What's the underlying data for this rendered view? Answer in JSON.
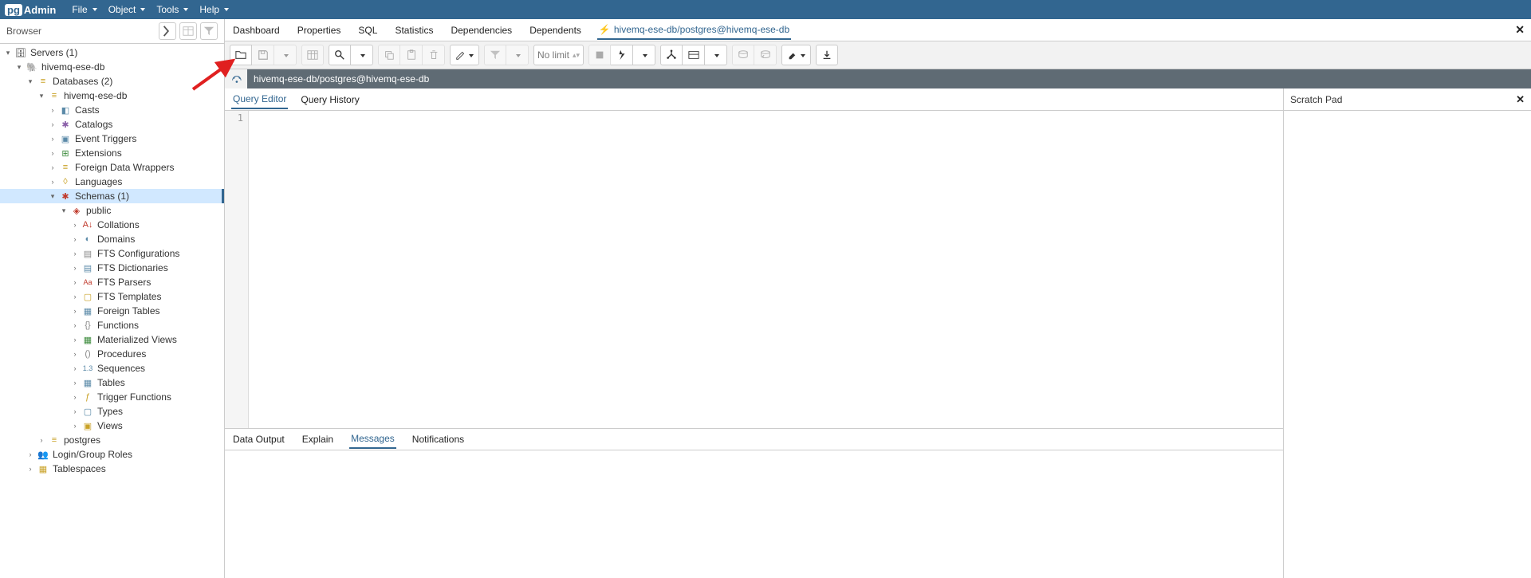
{
  "app": {
    "logo_pg": "pg",
    "logo_admin": "Admin"
  },
  "menu": {
    "file": "File",
    "object": "Object",
    "tools": "Tools",
    "help": "Help"
  },
  "browser": {
    "title": "Browser"
  },
  "tree": {
    "servers": "Servers (1)",
    "server": "hivemq-ese-db",
    "databases": "Databases (2)",
    "db": "hivemq-ese-db",
    "casts": "Casts",
    "catalogs": "Catalogs",
    "event_triggers": "Event Triggers",
    "extensions": "Extensions",
    "fdw": "Foreign Data Wrappers",
    "languages": "Languages",
    "schemas": "Schemas (1)",
    "public": "public",
    "collations": "Collations",
    "domains": "Domains",
    "fts_conf": "FTS Configurations",
    "fts_dict": "FTS Dictionaries",
    "fts_parsers": "FTS Parsers",
    "fts_templates": "FTS Templates",
    "foreign_tables": "Foreign Tables",
    "functions": "Functions",
    "mat_views": "Materialized Views",
    "procedures": "Procedures",
    "sequences": "Sequences",
    "tables": "Tables",
    "trigger_funcs": "Trigger Functions",
    "types": "Types",
    "views": "Views",
    "postgres": "postgres",
    "login_roles": "Login/Group Roles",
    "tablespaces": "Tablespaces"
  },
  "tabs": {
    "dashboard": "Dashboard",
    "properties": "Properties",
    "sql": "SQL",
    "statistics": "Statistics",
    "dependencies": "Dependencies",
    "dependents": "Dependents",
    "query": "hivemq-ese-db/postgres@hivemq-ese-db"
  },
  "toolbar": {
    "limit": "No limit"
  },
  "conn": {
    "text": "hivemq-ese-db/postgres@hivemq-ese-db"
  },
  "editor_tabs": {
    "query_editor": "Query Editor",
    "query_history": "Query History"
  },
  "editor": {
    "line1": "1"
  },
  "scratch": {
    "title": "Scratch Pad"
  },
  "bottom_tabs": {
    "data_output": "Data Output",
    "explain": "Explain",
    "messages": "Messages",
    "notifications": "Notifications"
  }
}
